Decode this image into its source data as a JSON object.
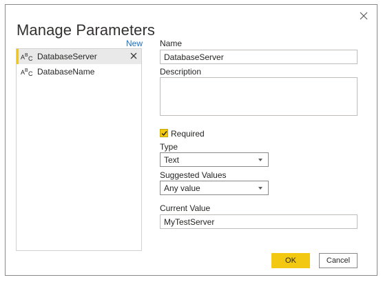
{
  "dialog": {
    "title": "Manage Parameters",
    "new_label": "New",
    "close_icon": "close-icon"
  },
  "parameters": [
    {
      "name": "DatabaseServer",
      "icon": "text-type-icon",
      "selected": true
    },
    {
      "name": "DatabaseName",
      "icon": "text-type-icon",
      "selected": false
    }
  ],
  "form": {
    "name_label": "Name",
    "name_value": "DatabaseServer",
    "description_label": "Description",
    "description_value": "",
    "required_label": "Required",
    "required_checked": true,
    "type_label": "Type",
    "type_value": "Text",
    "suggested_label": "Suggested Values",
    "suggested_value": "Any value",
    "current_label": "Current Value",
    "current_value": "MyTestServer"
  },
  "buttons": {
    "ok": "OK",
    "cancel": "Cancel"
  },
  "colors": {
    "accent": "#f2c811",
    "link": "#1b6ec2",
    "selected_bg": "#e9e9e9"
  }
}
